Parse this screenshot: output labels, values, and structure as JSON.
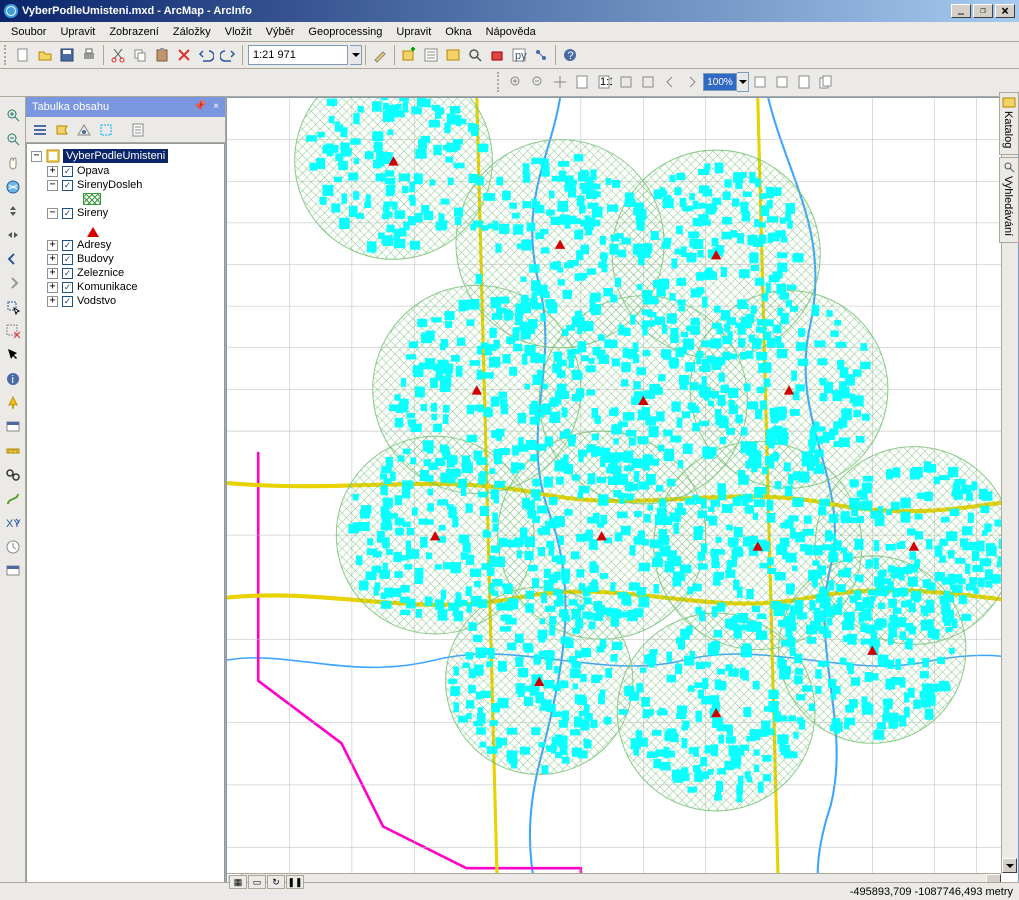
{
  "window": {
    "title": "VyberPodleUmisteni.mxd - ArcMap - ArcInfo"
  },
  "menu": {
    "items": [
      "Soubor",
      "Upravit",
      "Zobrazení",
      "Záložky",
      "Vložit",
      "Výběr",
      "Geoprocessing",
      "Upravit",
      "Okna",
      "Nápověda"
    ]
  },
  "toolbar1": {
    "scale": "1:21 971"
  },
  "toolbar2": {
    "zoom": "100%"
  },
  "toc": {
    "title": "Tabulka obsahu",
    "dataframe": "VyberPodleUmisteni",
    "layers": [
      {
        "name": "Opava",
        "expand": "+",
        "checked": true
      },
      {
        "name": "SirenyDosleh",
        "expand": "-",
        "checked": true,
        "symbol": "hatch"
      },
      {
        "name": "Sireny",
        "expand": "-",
        "checked": true,
        "symbol": "triangle"
      },
      {
        "name": "Adresy",
        "expand": "+",
        "checked": true
      },
      {
        "name": "Budovy",
        "expand": "+",
        "checked": true
      },
      {
        "name": "Zeleznice",
        "expand": "+",
        "checked": true
      },
      {
        "name": "Komunikace",
        "expand": "+",
        "checked": true
      },
      {
        "name": "Vodstvo",
        "expand": "+",
        "checked": true
      }
    ]
  },
  "right_tabs": [
    "Katalog",
    "Vyhledávání"
  ],
  "statusbar": {
    "coords": "-495893,709 -1087746,493 metry"
  },
  "colors": {
    "selection_cyan": "#00ffff",
    "buffer_green": "#6fbf6f",
    "boundary_magenta": "#ff00c8",
    "road_yellow": "#e8d200",
    "water_blue": "#3ea5ff"
  }
}
